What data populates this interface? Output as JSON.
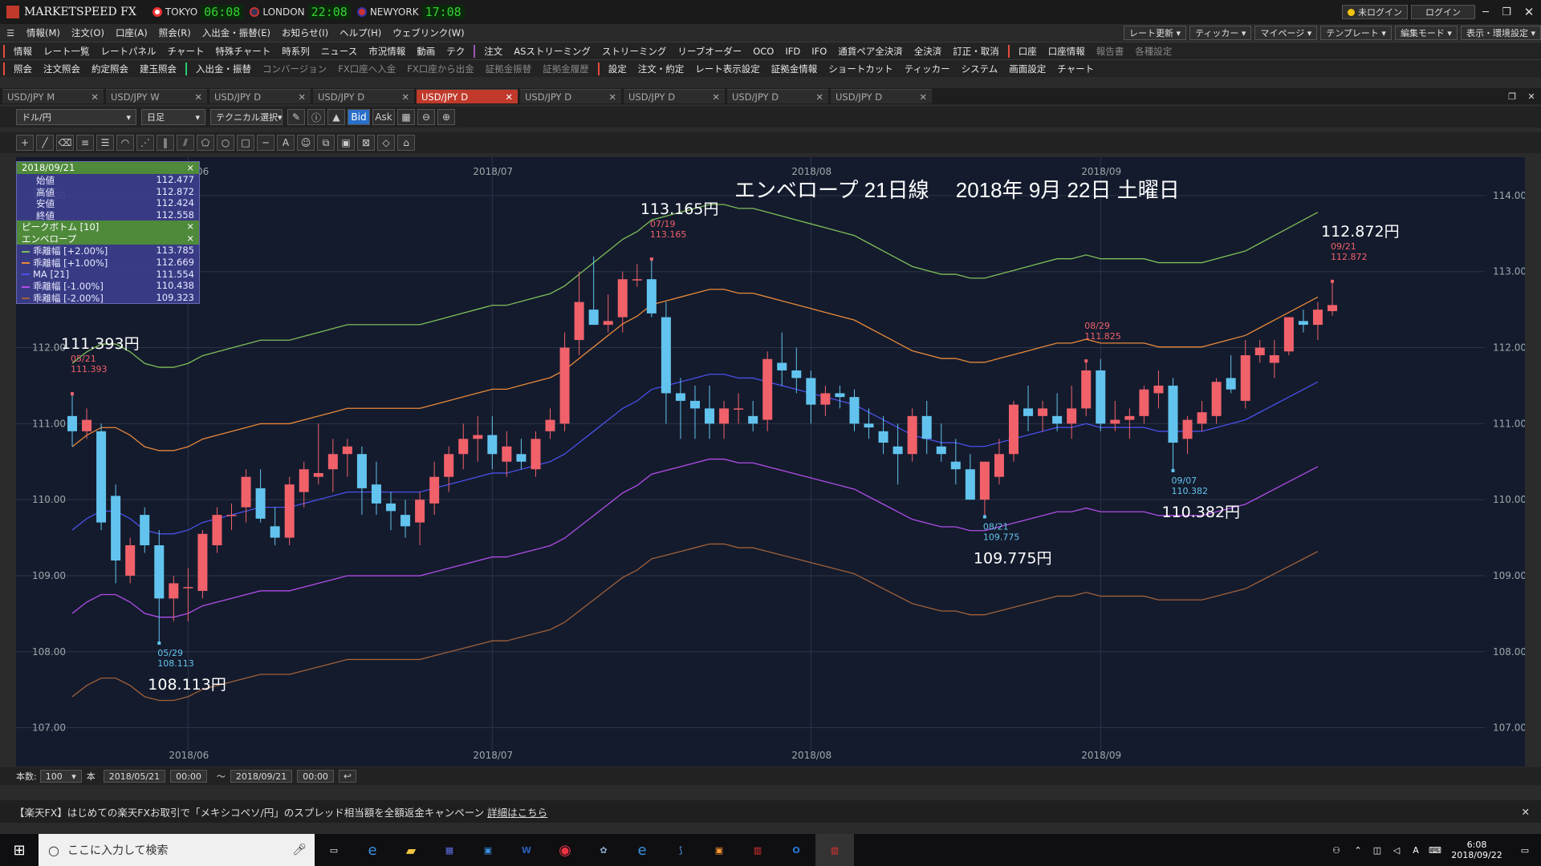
{
  "app": {
    "title": "MARKETSPEED FX",
    "clocks": [
      {
        "city": "TOKYO",
        "time": "06:08"
      },
      {
        "city": "LONDON",
        "time": "22:08"
      },
      {
        "city": "NEWYORK",
        "time": "17:08"
      }
    ],
    "login_status": "未ログイン",
    "login_button": "ログイン"
  },
  "menu": [
    "情報(M)",
    "注文(O)",
    "口座(A)",
    "照会(R)",
    "入出金・振替(E)",
    "お知らせ(I)",
    "ヘルプ(H)",
    "ウェブリンク(W)"
  ],
  "right_menu": [
    "レート更新",
    "ティッカー",
    "マイページ",
    "テンプレート",
    "編集モード",
    "表示・環境設定"
  ],
  "toolbar1": [
    "情報",
    "レート一覧",
    "レートパネル",
    "チャート",
    "特殊チャート",
    "時系列",
    "ニュース",
    "市況情報",
    "動画",
    "テク",
    "注文",
    "ASストリーミング",
    "ストリーミング",
    "リーブオーダー",
    "OCO",
    "IFD",
    "IFO",
    "通貨ペア全決済",
    "全決済",
    "訂正・取消",
    "口座",
    "口座情報",
    "報告書",
    "各種設定"
  ],
  "toolbar2": [
    "照会",
    "注文照会",
    "約定照会",
    "建玉照会",
    "入出金・振替",
    "コンバージョン",
    "FX口座へ入金",
    "FX口座から出金",
    "証拠金振替",
    "証拠金履歴",
    "設定",
    "注文・約定",
    "レート表示設定",
    "証拠金情報",
    "ショートカット",
    "ティッカー",
    "システム",
    "画面設定",
    "チャート"
  ],
  "tabs": [
    "USD/JPY M",
    "USD/JPY W",
    "USD/JPY D",
    "USD/JPY D",
    "USD/JPY D",
    "USD/JPY D",
    "USD/JPY D",
    "USD/JPY D",
    "USD/JPY D"
  ],
  "active_tab": 4,
  "controls": {
    "pair": "ドル/円",
    "timeframe": "日足",
    "technical": "テクニカル選択",
    "bid": "Bid",
    "ask": "Ask"
  },
  "info": {
    "date": "2018/09/21",
    "ohlc": [
      {
        "label": "始値",
        "value": "112.477"
      },
      {
        "label": "高値",
        "value": "112.872"
      },
      {
        "label": "安値",
        "value": "112.424"
      },
      {
        "label": "終値",
        "value": "112.558"
      }
    ],
    "peak": "ピークボトム [10]",
    "env": "エンベロープ",
    "lines": [
      {
        "label": "乖離幅 [+2.00%]",
        "value": "113.785",
        "color": "#7fbf5a"
      },
      {
        "label": "乖離幅 [+1.00%]",
        "value": "112.669",
        "color": "#e8893a"
      },
      {
        "label": "MA [21]",
        "value": "111.554",
        "color": "#4a50e8"
      },
      {
        "label": "乖離幅 [-1.00%]",
        "value": "110.438",
        "color": "#b04de8"
      },
      {
        "label": "乖離幅 [-2.00%]",
        "value": "109.323",
        "color": "#a0603a"
      }
    ]
  },
  "chart_data": {
    "type": "candlestick",
    "title": "エンベロープ 21日線　 2018年 9月 22日 土曜日",
    "ylim": [
      106.7,
      114.4
    ],
    "yticks": [
      "107.00",
      "108.00",
      "109.00",
      "110.00",
      "111.00",
      "112.00",
      "113.00",
      "114.00"
    ],
    "xticks": [
      "2018/06",
      "2018/07",
      "2018/08",
      "2018/09"
    ],
    "annotations": [
      {
        "date": "05/21",
        "price": "111.393",
        "big": "111.393円",
        "kind": "peak"
      },
      {
        "date": "05/29",
        "price": "108.113",
        "big": "108.113円",
        "kind": "bottom"
      },
      {
        "date": "07/19",
        "price": "113.165",
        "big": "113.165円",
        "kind": "peak"
      },
      {
        "date": "08/21",
        "price": "109.775",
        "big": "109.775円",
        "kind": "bottom"
      },
      {
        "date": "08/29",
        "price": "111.825",
        "big": "",
        "kind": "peak"
      },
      {
        "date": "09/07",
        "price": "110.382",
        "big": "110.382円",
        "kind": "bottom"
      },
      {
        "date": "09/21",
        "price": "112.872",
        "big": "112.872円",
        "kind": "peak"
      }
    ],
    "candles": [
      [
        111.1,
        111.39,
        110.7,
        110.9
      ],
      [
        110.9,
        111.2,
        110.8,
        111.05
      ],
      [
        110.9,
        111.0,
        109.6,
        109.7
      ],
      [
        110.05,
        110.2,
        108.9,
        109.2
      ],
      [
        109.0,
        109.5,
        108.9,
        109.4
      ],
      [
        109.8,
        109.9,
        109.3,
        109.4
      ],
      [
        109.4,
        109.6,
        108.11,
        108.7
      ],
      [
        108.7,
        109.0,
        108.4,
        108.9
      ],
      [
        108.85,
        109.1,
        108.4,
        108.85
      ],
      [
        108.8,
        109.6,
        108.7,
        109.55
      ],
      [
        109.4,
        109.9,
        109.3,
        109.8
      ],
      [
        109.8,
        109.95,
        109.6,
        109.8
      ],
      [
        109.9,
        110.4,
        109.7,
        110.3
      ],
      [
        110.15,
        110.4,
        109.7,
        109.75
      ],
      [
        109.65,
        109.9,
        109.4,
        109.5
      ],
      [
        109.5,
        110.3,
        109.4,
        110.2
      ],
      [
        110.1,
        110.5,
        109.9,
        110.4
      ],
      [
        110.3,
        111.0,
        110.2,
        110.35
      ],
      [
        110.4,
        110.8,
        110.1,
        110.6
      ],
      [
        110.6,
        110.8,
        110.3,
        110.7
      ],
      [
        110.6,
        110.7,
        109.8,
        110.15
      ],
      [
        110.2,
        110.5,
        109.8,
        109.95
      ],
      [
        109.95,
        110.1,
        109.6,
        109.85
      ],
      [
        109.8,
        110.0,
        109.5,
        109.65
      ],
      [
        109.7,
        110.1,
        109.4,
        110.0
      ],
      [
        109.95,
        110.5,
        109.8,
        110.3
      ],
      [
        110.3,
        110.7,
        110.1,
        110.6
      ],
      [
        110.6,
        111.0,
        110.4,
        110.8
      ],
      [
        110.8,
        111.1,
        110.5,
        110.85
      ],
      [
        110.85,
        111.1,
        110.4,
        110.6
      ],
      [
        110.5,
        110.9,
        110.3,
        110.7
      ],
      [
        110.6,
        110.8,
        110.4,
        110.5
      ],
      [
        110.4,
        110.9,
        110.3,
        110.8
      ],
      [
        110.9,
        111.2,
        110.8,
        111.05
      ],
      [
        111.0,
        112.2,
        110.9,
        112.0
      ],
      [
        112.1,
        113.0,
        111.9,
        112.6
      ],
      [
        112.5,
        113.2,
        112.3,
        112.3
      ],
      [
        112.3,
        112.7,
        112.2,
        112.35
      ],
      [
        112.4,
        113.0,
        112.2,
        112.9
      ],
      [
        112.9,
        113.1,
        112.8,
        112.9
      ],
      [
        112.9,
        113.17,
        112.4,
        112.45
      ],
      [
        112.4,
        112.6,
        111.0,
        111.4
      ],
      [
        111.4,
        111.6,
        110.8,
        111.3
      ],
      [
        111.3,
        111.5,
        110.8,
        111.2
      ],
      [
        111.2,
        111.5,
        110.8,
        111.0
      ],
      [
        111.0,
        111.3,
        110.8,
        111.2
      ],
      [
        111.2,
        111.4,
        111.0,
        111.2
      ],
      [
        111.1,
        111.3,
        110.9,
        111.0
      ],
      [
        111.05,
        111.95,
        110.9,
        111.85
      ],
      [
        111.8,
        112.2,
        111.5,
        111.7
      ],
      [
        111.7,
        112.0,
        111.4,
        111.6
      ],
      [
        111.6,
        111.7,
        111.0,
        111.25
      ],
      [
        111.25,
        111.5,
        111.1,
        111.4
      ],
      [
        111.4,
        111.5,
        111.2,
        111.35
      ],
      [
        111.35,
        111.45,
        110.9,
        111.0
      ],
      [
        111.0,
        111.2,
        110.8,
        110.95
      ],
      [
        110.9,
        111.1,
        110.6,
        110.75
      ],
      [
        110.7,
        111.0,
        110.2,
        110.6
      ],
      [
        110.6,
        111.2,
        110.5,
        111.1
      ],
      [
        111.1,
        111.3,
        110.6,
        110.8
      ],
      [
        110.7,
        111.0,
        110.5,
        110.6
      ],
      [
        110.5,
        110.8,
        110.2,
        110.4
      ],
      [
        110.4,
        110.6,
        110.0,
        110.0
      ],
      [
        110.0,
        110.5,
        109.78,
        110.5
      ],
      [
        110.3,
        110.8,
        110.2,
        110.6
      ],
      [
        110.6,
        111.3,
        110.5,
        111.25
      ],
      [
        111.2,
        111.5,
        110.9,
        111.1
      ],
      [
        111.1,
        111.3,
        110.9,
        111.2
      ],
      [
        111.1,
        111.4,
        110.9,
        111.0
      ],
      [
        111.0,
        111.5,
        110.8,
        111.2
      ],
      [
        111.2,
        111.8,
        111.1,
        111.7
      ],
      [
        111.7,
        111.85,
        110.9,
        111.0
      ],
      [
        111.0,
        111.3,
        110.9,
        111.05
      ],
      [
        111.05,
        111.2,
        110.8,
        111.1
      ],
      [
        111.1,
        111.5,
        111.0,
        111.45
      ],
      [
        111.4,
        111.7,
        111.2,
        111.5
      ],
      [
        111.5,
        111.6,
        110.38,
        110.75
      ],
      [
        110.8,
        111.1,
        110.6,
        111.05
      ],
      [
        111.0,
        111.3,
        110.9,
        111.15
      ],
      [
        111.1,
        111.6,
        111.0,
        111.55
      ],
      [
        111.6,
        111.9,
        111.4,
        111.45
      ],
      [
        111.3,
        112.1,
        111.2,
        111.9
      ],
      [
        111.9,
        112.1,
        111.8,
        112.0
      ],
      [
        111.8,
        112.1,
        111.6,
        111.9
      ],
      [
        111.95,
        112.4,
        111.9,
        112.4
      ],
      [
        112.35,
        112.5,
        112.2,
        112.3
      ],
      [
        112.3,
        112.6,
        112.1,
        112.5
      ],
      [
        112.48,
        112.87,
        112.42,
        112.56
      ]
    ],
    "envelope": {
      "ma": [
        109.6,
        109.75,
        109.85,
        109.85,
        109.75,
        109.6,
        109.55,
        109.55,
        109.6,
        109.7,
        109.75,
        109.8,
        109.85,
        109.9,
        109.9,
        109.9,
        109.95,
        110.0,
        110.05,
        110.1,
        110.1,
        110.1,
        110.1,
        110.1,
        110.1,
        110.15,
        110.2,
        110.25,
        110.3,
        110.35,
        110.35,
        110.4,
        110.45,
        110.5,
        110.6,
        110.75,
        110.9,
        111.05,
        111.2,
        111.3,
        111.45,
        111.5,
        111.55,
        111.6,
        111.65,
        111.65,
        111.6,
        111.6,
        111.55,
        111.5,
        111.45,
        111.4,
        111.35,
        111.3,
        111.25,
        111.15,
        111.05,
        110.95,
        110.85,
        110.8,
        110.75,
        110.75,
        110.7,
        110.7,
        110.75,
        110.8,
        110.85,
        110.9,
        110.95,
        110.95,
        111.0,
        110.95,
        110.95,
        110.95,
        110.95,
        110.9,
        110.9,
        110.9,
        110.9,
        110.95,
        111.0,
        111.05,
        111.15,
        111.25,
        111.35,
        111.45,
        111.55
      ]
    }
  },
  "footer": {
    "count_label": "本数:",
    "count": "100",
    "unit": "本",
    "from": "2018/05/21",
    "to": "2018/09/21",
    "time1": "00:00",
    "time2": "00:00",
    "tilde": "〜"
  },
  "promo": {
    "text": "【楽天FX】はじめての楽天FXお取引で「メキシコペソ/円」のスプレッド相当額を全額返金キャンペーン",
    "link": "詳細はこちら"
  },
  "taskbar": {
    "search": "ここに入力して検索",
    "time": "6:08",
    "date": "2018/09/22"
  }
}
